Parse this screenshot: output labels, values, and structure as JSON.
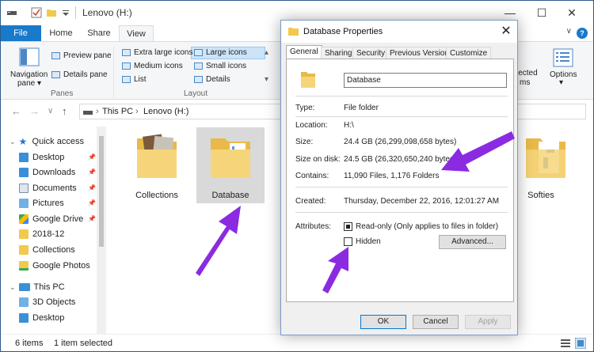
{
  "window": {
    "title": "Lenovo (H:)",
    "title_separator": "|"
  },
  "ribbon": {
    "tabs": [
      "File",
      "Home",
      "Share",
      "View"
    ],
    "active_tab": "View",
    "panes_group": {
      "navigation_pane_label_1": "Navigation",
      "navigation_pane_label_2": "pane",
      "preview_pane": "Preview pane",
      "details_pane": "Details pane",
      "group_label": "Panes"
    },
    "layout_group": {
      "items": [
        "Extra large icons",
        "Large icons",
        "Medium icons",
        "Small icons",
        "List",
        "Details"
      ],
      "selected": "Large icons",
      "group_label": "Layout"
    },
    "right_fragment": "lected",
    "right_fragment_2": "ms",
    "options_label": "Options"
  },
  "address": {
    "path": [
      "This PC",
      "Lenovo (H:)"
    ]
  },
  "nav_pane": {
    "items": [
      {
        "label": "Quick access",
        "icon": "star-icon",
        "pinned": false
      },
      {
        "label": "Desktop",
        "icon": "desktop-folder-icon",
        "pinned": true
      },
      {
        "label": "Downloads",
        "icon": "downloads-icon",
        "pinned": true
      },
      {
        "label": "Documents",
        "icon": "documents-icon",
        "pinned": true
      },
      {
        "label": "Pictures",
        "icon": "pictures-icon",
        "pinned": true
      },
      {
        "label": "Google Drive",
        "icon": "google-drive-icon",
        "pinned": true
      },
      {
        "label": "2018-12",
        "icon": "folder-icon",
        "pinned": false
      },
      {
        "label": "Collections",
        "icon": "folder-icon",
        "pinned": false
      },
      {
        "label": "Google Photos",
        "icon": "folder-check-icon",
        "pinned": false
      },
      {
        "label": "This PC",
        "icon": "computer-icon",
        "pinned": false
      },
      {
        "label": "3D Objects",
        "icon": "3d-objects-icon",
        "pinned": false
      },
      {
        "label": "Desktop",
        "icon": "desktop-folder-icon",
        "pinned": false
      }
    ]
  },
  "content": {
    "items": [
      {
        "label": "Collections",
        "selected": false
      },
      {
        "label": "Database",
        "selected": true
      },
      {
        "label": "Softies",
        "selected": false
      }
    ]
  },
  "status": {
    "count": "6 items",
    "selection": "1 item selected"
  },
  "dialog": {
    "title": "Database Properties",
    "tabs": [
      "General",
      "Sharing",
      "Security",
      "Previous Versions",
      "Customize"
    ],
    "active_tab": "General",
    "name": "Database",
    "type_label": "Type:",
    "type_value": "File folder",
    "location_label": "Location:",
    "location_value": "H:\\",
    "size_label": "Size:",
    "size_value": "24.4 GB (26,299,098,658 bytes)",
    "size_on_disk_label": "Size on disk:",
    "size_on_disk_value": "24.5 GB (26,320,650,240 bytes)",
    "contains_label": "Contains:",
    "contains_value": "11,090 Files, 1,176 Folders",
    "created_label": "Created:",
    "created_value": "Thursday, December 22, 2016, 12:01:27 AM",
    "attributes_label": "Attributes:",
    "readonly_label": "Read-only (Only applies to files in folder)",
    "readonly_checked": true,
    "hidden_label": "Hidden",
    "hidden_checked": false,
    "advanced_button": "Advanced...",
    "ok_button": "OK",
    "cancel_button": "Cancel",
    "apply_button": "Apply"
  },
  "colors": {
    "accent": "#1979ca",
    "arrow": "#8a2be2",
    "selection": "#cce4f7"
  }
}
